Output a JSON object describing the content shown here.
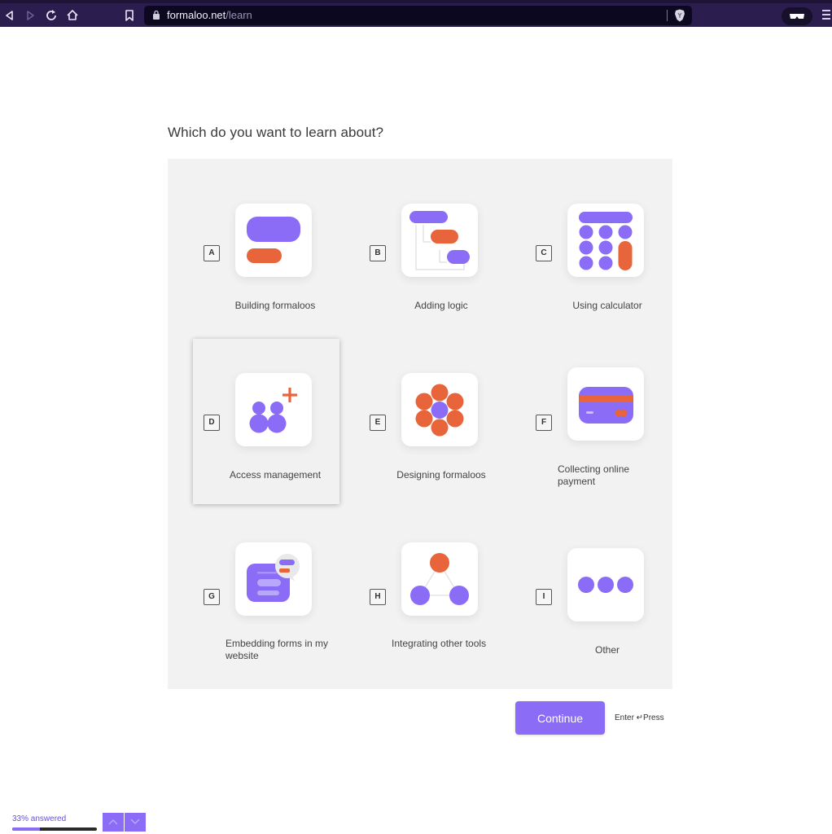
{
  "browser": {
    "url_domain": "formaloo.net",
    "url_path": "/learn"
  },
  "question": {
    "title": "Which do you want to learn about?"
  },
  "options": [
    {
      "key": "A",
      "label": "Building formaloos",
      "icon": "form-blocks-icon"
    },
    {
      "key": "B",
      "label": "Adding logic",
      "icon": "logic-flow-icon"
    },
    {
      "key": "C",
      "label": "Using calculator",
      "icon": "calculator-icon"
    },
    {
      "key": "D",
      "label": "Access management",
      "icon": "users-add-icon",
      "selected": true
    },
    {
      "key": "E",
      "label": "Designing formaloos",
      "icon": "flower-palette-icon"
    },
    {
      "key": "F",
      "label": "Collecting online payment",
      "icon": "credit-card-icon"
    },
    {
      "key": "G",
      "label": "Embedding forms in my website",
      "icon": "embed-chat-icon"
    },
    {
      "key": "H",
      "label": "Integrating other tools",
      "icon": "integration-triangle-icon"
    },
    {
      "key": "I",
      "label": "Other",
      "icon": "more-dots-icon"
    }
  ],
  "actions": {
    "continue_label": "Continue",
    "enter_hint": "Enter ↵Press"
  },
  "progress": {
    "text": "33% answered",
    "value_percent": 33
  },
  "colors": {
    "accent_purple": "#8a6cf7",
    "accent_orange": "#e8643a",
    "browser_bg": "#2b1d4e"
  }
}
